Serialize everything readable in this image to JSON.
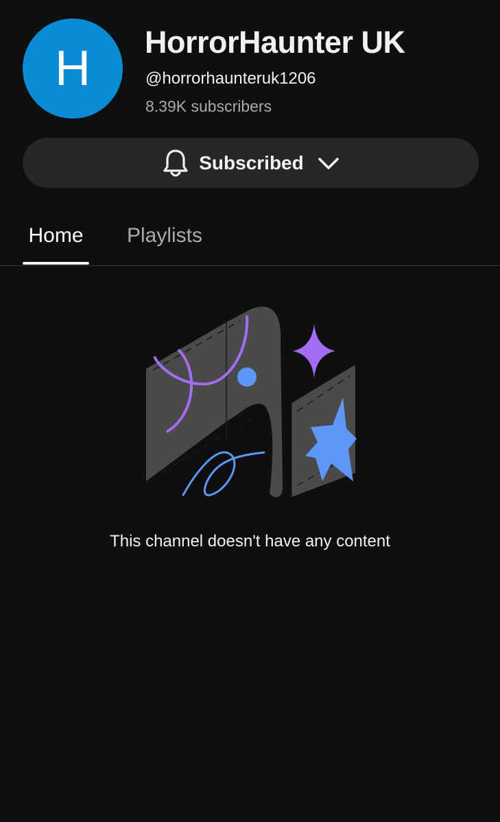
{
  "channel": {
    "avatar_letter": "H",
    "avatar_color": "#0b8ad6",
    "name": "HorrorHaunter UK",
    "handle": "@horrorhaunteruk1206",
    "subscribers": "8.39K subscribers"
  },
  "subscribe_button": {
    "label": "Subscribed",
    "icon": "bell-icon",
    "dropdown_icon": "chevron-down-icon"
  },
  "tabs": [
    {
      "label": "Home",
      "active": true
    },
    {
      "label": "Playlists",
      "active": false
    }
  ],
  "empty_state": {
    "message": "This channel doesn't have any content",
    "illustration": "empty-channel-illustration"
  },
  "colors": {
    "background": "#0f0f0f",
    "button_bg": "#272727",
    "accent_purple": "#a46cf5",
    "accent_blue": "#5e97f6"
  }
}
